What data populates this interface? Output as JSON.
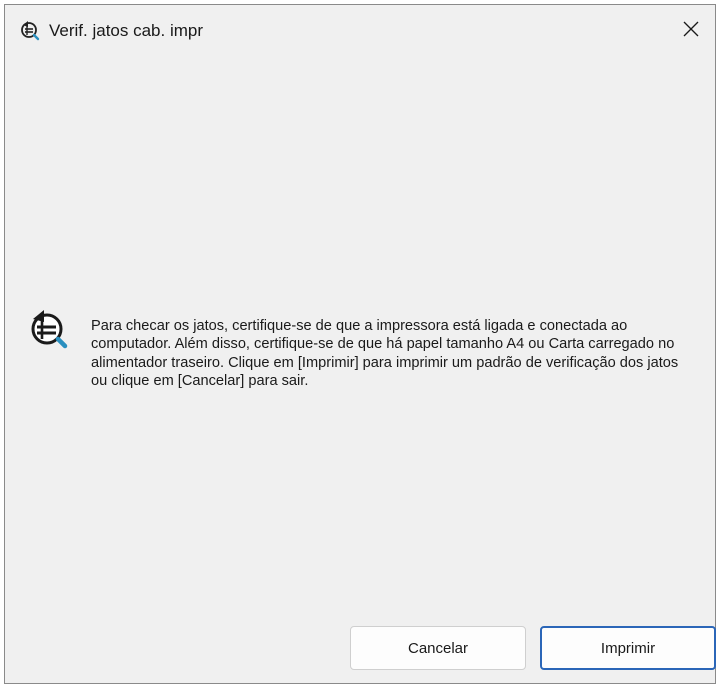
{
  "window": {
    "title": "Verif. jatos cab. impr",
    "icon": "nozzle-check-icon",
    "close_icon": "close-icon"
  },
  "message": {
    "icon": "nozzle-check-icon",
    "text": "Para checar os jatos, certifique-se de que a impressora está ligada e conectada ao computador. Além disso, certifique-se de que há papel tamanho A4 ou Carta carregado no alimentador traseiro. Clique em [Imprimir] para imprimir um padrão de verificação dos jatos ou clique em [Cancelar] para sair."
  },
  "buttons": {
    "cancel_label": "Cancelar",
    "print_label": "Imprimir"
  },
  "colors": {
    "accent": "#2b66b8",
    "background": "#f0f0f0"
  }
}
